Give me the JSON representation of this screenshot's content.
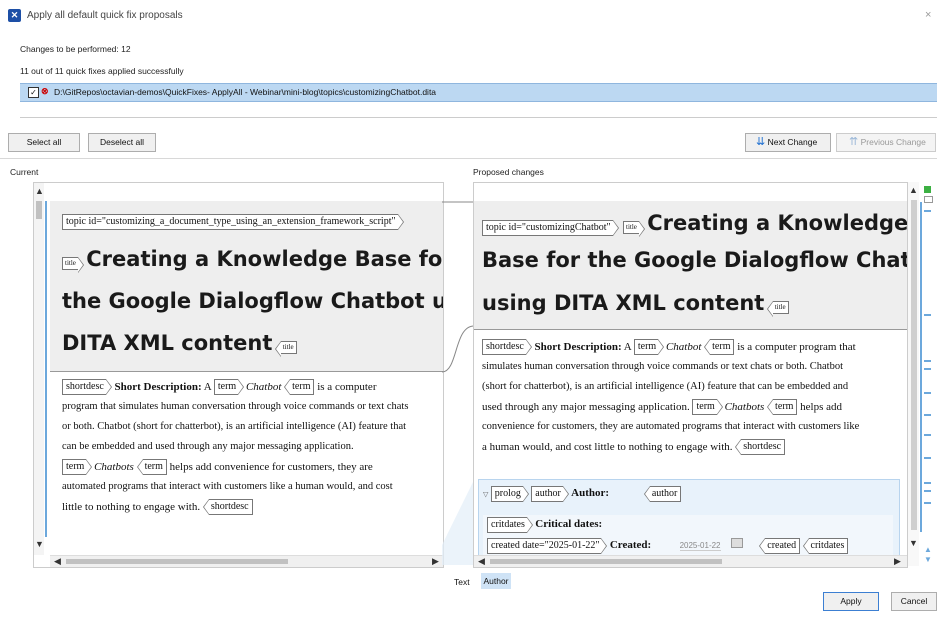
{
  "window": {
    "title": "Apply all default quick fix proposals",
    "close_symbol": "×"
  },
  "summary": {
    "changes_line": "Changes to be performed: 12",
    "applied_line": "11 out of 11 quick fixes applied successfully"
  },
  "file": {
    "checked": true,
    "path": "D:\\GitRepos\\octavian-demos\\QuickFixes- ApplyAll - Webinar\\mini-blog\\topics\\customizingChatbot.dita"
  },
  "buttons": {
    "select_all": "Select all",
    "deselect_all": "Deselect all",
    "next_change": "Next Change",
    "previous_change": "Previous Change",
    "apply": "Apply",
    "cancel": "Cancel"
  },
  "panes": {
    "current_label": "Current",
    "proposed_label": "Proposed changes"
  },
  "current": {
    "topic_tag": "topic id=\"customizing_a_document_type_using_an_extension_framework_script\"",
    "title_tag": "title",
    "title_lines": [
      "Creating a Knowledge Base for",
      "the Google Dialogflow Chatbot using",
      "DITA XML content"
    ],
    "shortdesc_tag": "shortdesc",
    "short_label": "Short Description:",
    "a_word": "A",
    "term_tag": "term",
    "term1": "Chatbot",
    "line1_rest": "is a computer",
    "lines": [
      "program that simulates human conversation through voice commands or text chats",
      "or both. Chatbot (short for chatterbot), is an artificial intelligence (AI) feature that",
      "can be embedded and used through any major messaging application."
    ],
    "term2": "Chatbots",
    "line5_rest": "helps add convenience for customers, they are",
    "line6": "automated programs that interact with customers like a human would, and cost",
    "line7": "little to nothing to engage with."
  },
  "proposed": {
    "topic_tag": "topic id=\"customizingChatbot\"",
    "title_tag": "title",
    "title_line1": "Creating a Knowledge",
    "title_line2": "Base for the Google Dialogflow Chatbot",
    "title_line3": "using DITA XML content",
    "shortdesc_tag": "shortdesc",
    "short_label": "Short Description:",
    "a_word": "A",
    "term_tag": "term",
    "term1": "Chatbot",
    "line1_rest": "is a computer program that",
    "lines": [
      "simulates human conversation through voice commands or text chats or both. Chatbot",
      "(short for chatterbot), is an artificial intelligence (AI) feature that can be embedded and"
    ],
    "line4_start": "used through any major messaging application.",
    "term2": "Chatbots",
    "line4_rest": "helps add",
    "line5": "convenience for customers, they are automated programs that interact with customers like",
    "line6": "a human would, and cost little to nothing to engage with.",
    "prolog_tag": "prolog",
    "author_tag": "author",
    "author_label": "Author:",
    "critdates_tag": "critdates",
    "critdates_label": "Critical dates:",
    "created_tag": "created date=\"2025-01-22\"",
    "created_label": "Created:",
    "created_value": "2025-01-22"
  },
  "bottom_tabs": {
    "text": "Text",
    "author": "Author"
  },
  "colors": {
    "accent": "#1d4fa6",
    "file_row": "#bcd8f2",
    "marker": "#6ca8dc",
    "ok": "#3cb043"
  }
}
